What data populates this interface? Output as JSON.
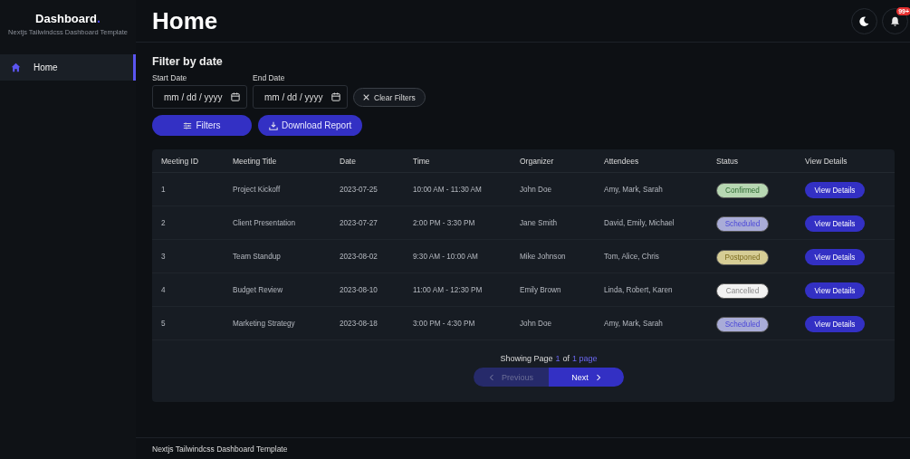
{
  "sidebar": {
    "brand": "Dashboard",
    "brand_dot": ".",
    "subtitle": "Nextjs Tailwindcss Dashboard Template",
    "items": [
      {
        "label": "Home",
        "selected": true
      }
    ]
  },
  "header": {
    "title": "Home",
    "notification_badge": "99+"
  },
  "filter": {
    "title": "Filter by date",
    "fields": [
      {
        "label": "Start Date",
        "placeholder": "mm / dd / yyyy"
      },
      {
        "label": "End Date",
        "placeholder": "mm / dd / yyyy"
      }
    ],
    "clear_button": "Clear Filters",
    "filters_button": "Filters",
    "download_button": "Download Report"
  },
  "table": {
    "columns": [
      "Meeting ID",
      "Meeting Title",
      "Date",
      "Time",
      "Organizer",
      "Attendees",
      "Status",
      "View Details"
    ],
    "rows": [
      {
        "id": "1",
        "title": "Project Kickoff",
        "date": "2023-07-25",
        "time": "10:00 AM - 11:30 AM",
        "organizer": "John Doe",
        "attendees": "Amy, Mark, Sarah",
        "status": "Confirmed",
        "kind": "confirmed",
        "action": "View Details"
      },
      {
        "id": "2",
        "title": "Client Presentation",
        "date": "2023-07-27",
        "time": "2:00 PM - 3:30 PM",
        "organizer": "Jane Smith",
        "attendees": "David, Emily, Michael",
        "status": "Scheduled",
        "kind": "scheduled",
        "action": "View Details"
      },
      {
        "id": "3",
        "title": "Team Standup",
        "date": "2023-08-02",
        "time": "9:30 AM - 10:00 AM",
        "organizer": "Mike Johnson",
        "attendees": "Tom, Alice, Chris",
        "status": "Postponed",
        "kind": "postponed",
        "action": "View Details"
      },
      {
        "id": "4",
        "title": "Budget Review",
        "date": "2023-08-10",
        "time": "11:00 AM - 12:30 PM",
        "organizer": "Emily Brown",
        "attendees": "Linda, Robert, Karen",
        "status": "Cancelled",
        "kind": "cancelled",
        "action": "View Details"
      },
      {
        "id": "5",
        "title": "Marketing Strategy",
        "date": "2023-08-18",
        "time": "3:00 PM - 4:30 PM",
        "organizer": "John Doe",
        "attendees": "Amy, Mark, Sarah",
        "status": "Scheduled",
        "kind": "scheduled",
        "action": "View Details"
      }
    ]
  },
  "pagination": {
    "prefix": "Showing Page",
    "page": "1",
    "of": "of",
    "total": "1 page",
    "previous": {
      "label": "Previous",
      "disabled": true
    },
    "next": {
      "label": "Next",
      "disabled": false
    }
  },
  "footer": "Nextjs Tailwindcss Dashboard Template"
}
